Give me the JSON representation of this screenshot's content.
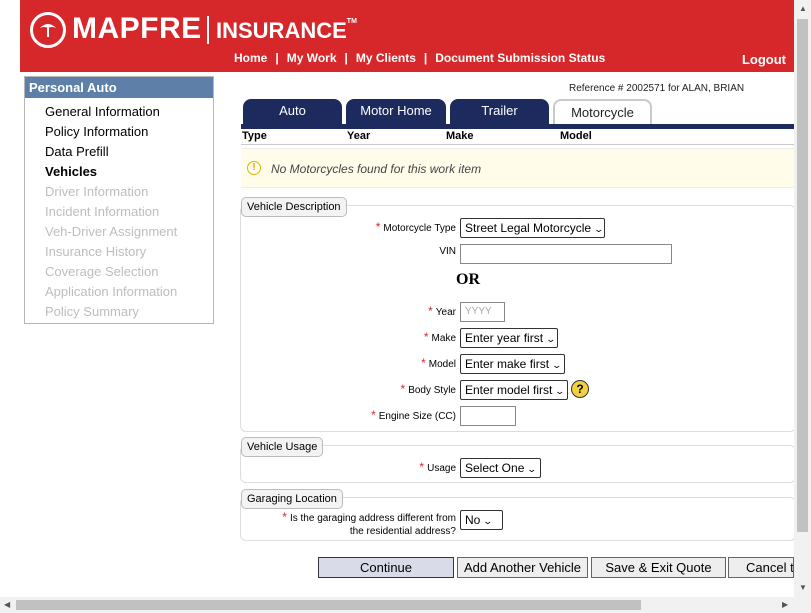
{
  "header": {
    "brand": "MAPFRE",
    "brand_sub": "INSURANCE",
    "nav": [
      "Home",
      "My Work",
      "My Clients",
      "Document Submission Status"
    ],
    "logout": "Logout"
  },
  "sidebar": {
    "title": "Personal Auto",
    "items": [
      {
        "label": "General Information",
        "state": "normal"
      },
      {
        "label": "Policy Information",
        "state": "normal"
      },
      {
        "label": "Data Prefill",
        "state": "normal"
      },
      {
        "label": "Vehicles",
        "state": "active"
      },
      {
        "label": "Driver Information",
        "state": "disabled"
      },
      {
        "label": "Incident Information",
        "state": "disabled"
      },
      {
        "label": "Veh-Driver Assignment",
        "state": "disabled"
      },
      {
        "label": "Insurance History",
        "state": "disabled"
      },
      {
        "label": "Coverage Selection",
        "state": "disabled"
      },
      {
        "label": "Application Information",
        "state": "disabled"
      },
      {
        "label": "Policy Summary",
        "state": "disabled"
      }
    ]
  },
  "reference": "Reference # 2002571 for ALAN, BRIAN",
  "tabs": [
    "Auto",
    "Motor Home",
    "Trailer",
    "Motorcycle"
  ],
  "table": {
    "headers": [
      "Type",
      "Year",
      "Make",
      "Model"
    ],
    "empty_message": "No Motorcycles found for this work item"
  },
  "vehicle_description": {
    "legend": "Vehicle Description",
    "motorcycle_type_label": "Motorcycle Type",
    "motorcycle_type_value": "Street Legal Motorcycle",
    "vin_label": "VIN",
    "or_text": "OR",
    "year_label": "Year",
    "year_placeholder": "YYYY",
    "make_label": "Make",
    "make_value": "Enter year first",
    "model_label": "Model",
    "model_value": "Enter make first",
    "body_style_label": "Body Style",
    "body_style_value": "Enter model first",
    "help": "?",
    "engine_label": "Engine Size (CC)"
  },
  "vehicle_usage": {
    "legend": "Vehicle Usage",
    "usage_label": "Usage",
    "usage_value": "Select One"
  },
  "garaging": {
    "legend": "Garaging Location",
    "question_line1": "Is the garaging address different from",
    "question_line2": "the residential address?",
    "answer": "No"
  },
  "buttons": {
    "continue": "Continue",
    "add_another": "Add Another Vehicle",
    "save_exit": "Save & Exit Quote",
    "cancel": "Cancel t"
  },
  "colors": {
    "brand_red": "#d6282b",
    "tab_navy": "#1c2a5e",
    "sidebar_title_bg": "#5d7fa8"
  }
}
